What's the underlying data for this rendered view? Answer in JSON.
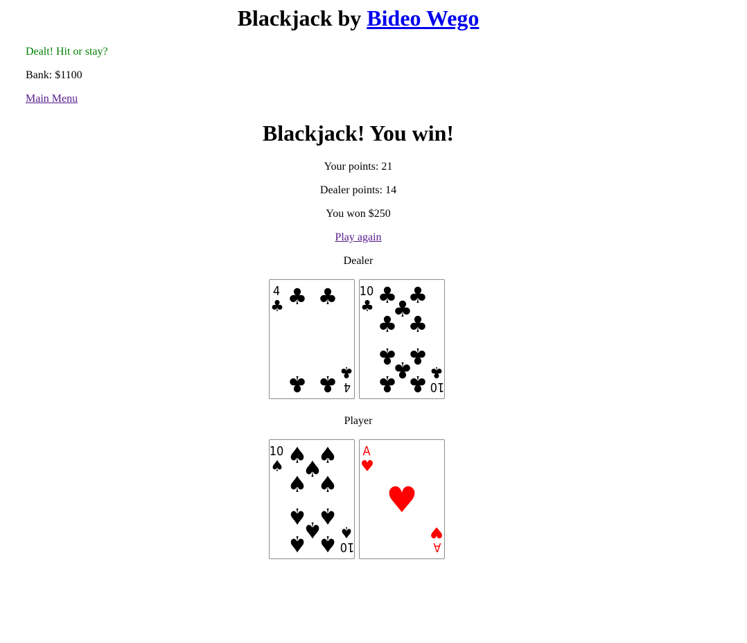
{
  "header": {
    "title_prefix": "Blackjack by ",
    "author_link": "Bideo Wego"
  },
  "status": {
    "message": "Dealt! Hit or stay?",
    "bank": "Bank: $1100",
    "main_menu": "Main Menu"
  },
  "result": {
    "heading": "Blackjack! You win!",
    "your_points": "Your points: 21",
    "dealer_points": "Dealer points: 14",
    "won": "You won $250",
    "play_again": "Play again"
  },
  "dealer": {
    "label": "Dealer",
    "cards": [
      {
        "rank": "4",
        "suit": "clubs"
      },
      {
        "rank": "10",
        "suit": "clubs"
      }
    ]
  },
  "player": {
    "label": "Player",
    "cards": [
      {
        "rank": "10",
        "suit": "spades"
      },
      {
        "rank": "A",
        "suit": "hearts"
      }
    ]
  },
  "colors": {
    "status_green": "#008000",
    "link_blue": "#0000ee",
    "visited_purple": "#551a8b",
    "heart_red": "#ff0000"
  }
}
